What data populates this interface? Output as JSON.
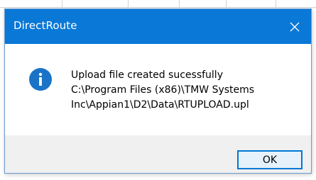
{
  "dialog": {
    "title": "DirectRoute",
    "message_lines": [
      "Upload file created sucessfully",
      "C:\\Program Files (x86)\\TMW Systems",
      "Inc\\Appian1\\D2\\Data\\RTUPLOAD.upl"
    ],
    "ok_label": "OK",
    "icon": "info-icon",
    "close_icon": "close-icon"
  },
  "colors": {
    "titlebar": "#0a78d7",
    "title_text": "#ffffff",
    "info_icon": "#1a73c7",
    "footer": "#f0f0f0",
    "ok_border": "#0078d7",
    "ok_fill": "#e5f1fb"
  }
}
